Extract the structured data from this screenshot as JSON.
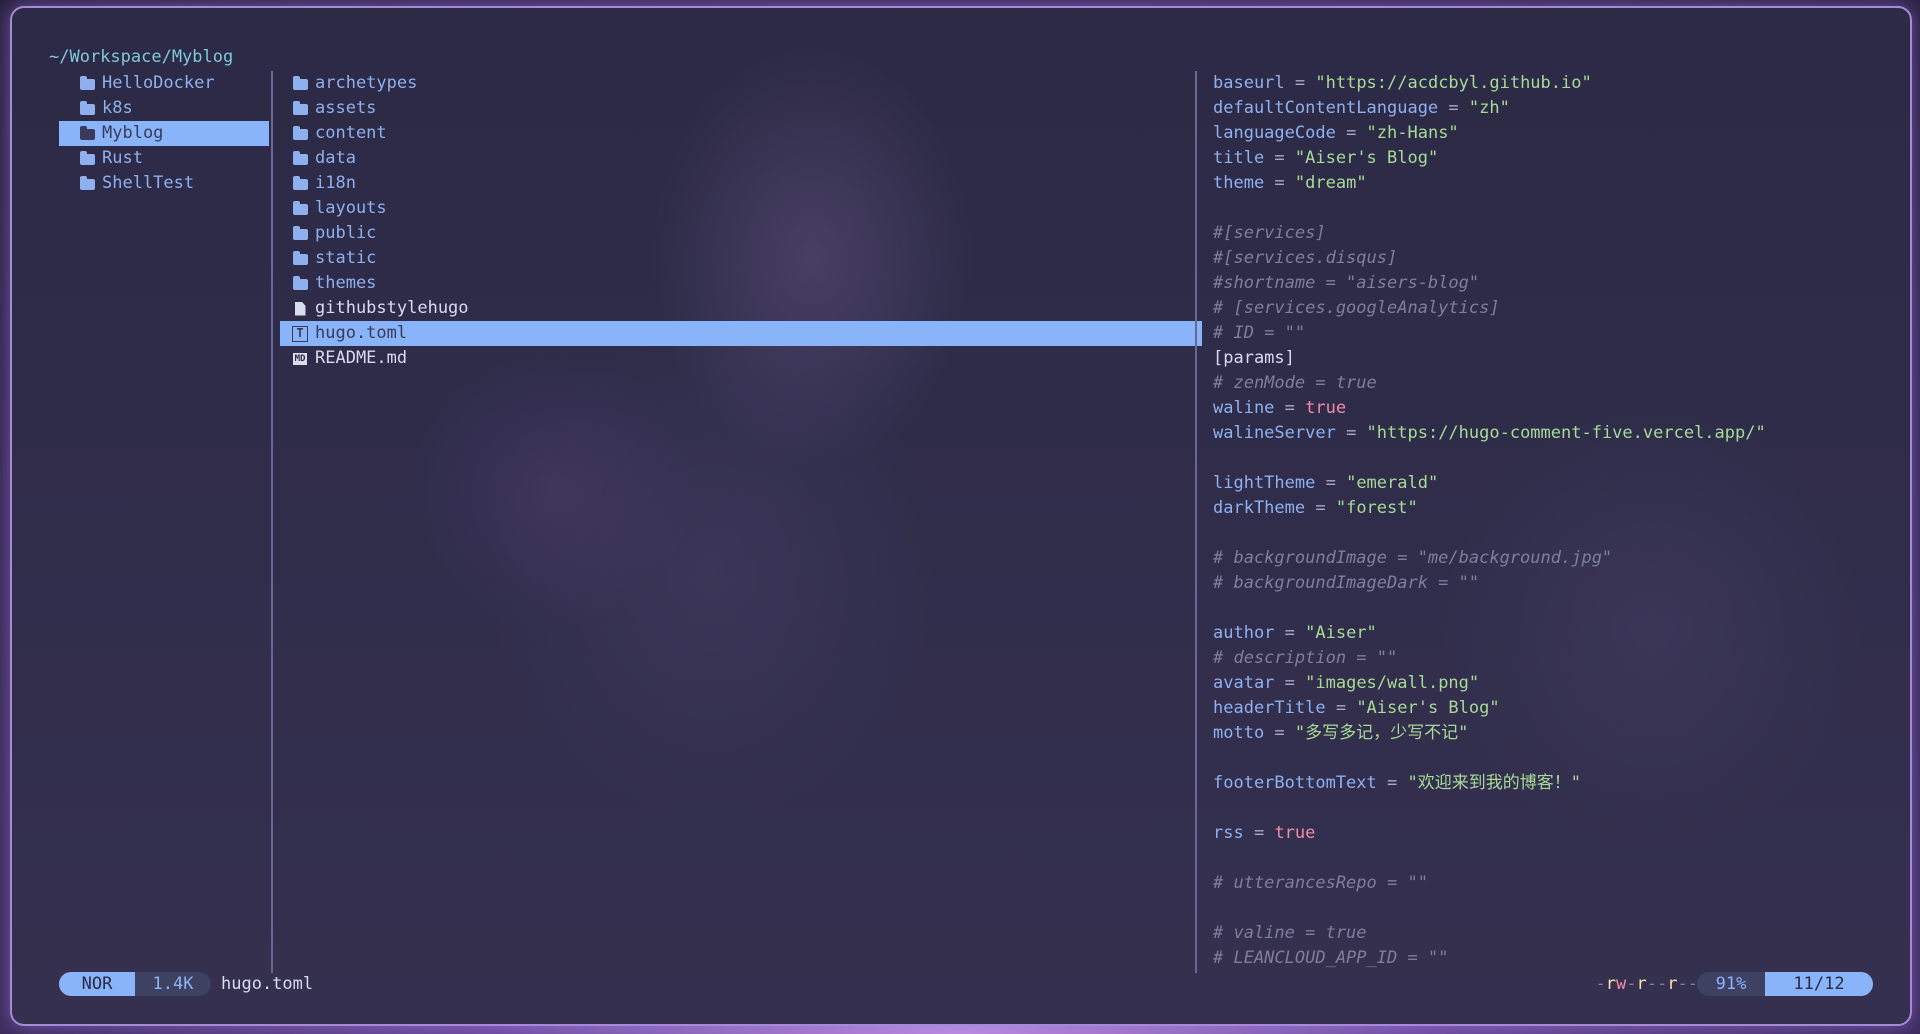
{
  "cwd": "~/Workspace/Myblog",
  "parent": [
    {
      "name": "HelloDocker",
      "selected": false
    },
    {
      "name": "k8s",
      "selected": false
    },
    {
      "name": "Myblog",
      "selected": true
    },
    {
      "name": "Rust",
      "selected": false
    },
    {
      "name": "ShellTest",
      "selected": false
    }
  ],
  "current": [
    {
      "name": "archetypes",
      "type": "dir"
    },
    {
      "name": "assets",
      "type": "dir"
    },
    {
      "name": "content",
      "type": "dir"
    },
    {
      "name": "data",
      "type": "dir"
    },
    {
      "name": "i18n",
      "type": "dir"
    },
    {
      "name": "layouts",
      "type": "dir"
    },
    {
      "name": "public",
      "type": "dir"
    },
    {
      "name": "static",
      "type": "dir"
    },
    {
      "name": "themes",
      "type": "dir"
    },
    {
      "name": "githubstylehugo",
      "type": "file"
    },
    {
      "name": "hugo.toml",
      "type": "toml",
      "selected": true
    },
    {
      "name": "README.md",
      "type": "md"
    }
  ],
  "preview": [
    [
      [
        "k",
        "baseurl"
      ],
      [
        "eq",
        " = "
      ],
      [
        "s",
        "\"https://acdcbyl.github.io\""
      ]
    ],
    [
      [
        "k",
        "defaultContentLanguage"
      ],
      [
        "eq",
        " = "
      ],
      [
        "s",
        "\"zh\""
      ]
    ],
    [
      [
        "k",
        "languageCode"
      ],
      [
        "eq",
        " = "
      ],
      [
        "s",
        "\"zh-Hans\""
      ]
    ],
    [
      [
        "k",
        "title"
      ],
      [
        "eq",
        " = "
      ],
      [
        "s",
        "\"Aiser's Blog\""
      ]
    ],
    [
      [
        "k",
        "theme"
      ],
      [
        "eq",
        " = "
      ],
      [
        "s",
        "\"dream\""
      ]
    ],
    [],
    [
      [
        "c",
        "#[services]"
      ]
    ],
    [
      [
        "c",
        "#[services.disqus]"
      ]
    ],
    [
      [
        "c",
        "#shortname = \"aisers-blog\""
      ]
    ],
    [
      [
        "c",
        "# [services.googleAnalytics]"
      ]
    ],
    [
      [
        "c",
        "# ID = \"\""
      ]
    ],
    [
      [
        "br",
        "[params]"
      ]
    ],
    [
      [
        "c",
        "# zenMode = true"
      ]
    ],
    [
      [
        "k",
        "waline"
      ],
      [
        "eq",
        " = "
      ],
      [
        "b",
        "true"
      ]
    ],
    [
      [
        "k",
        "walineServer"
      ],
      [
        "eq",
        " = "
      ],
      [
        "s",
        "\"https://hugo-comment-five.vercel.app/\""
      ]
    ],
    [],
    [
      [
        "k",
        "lightTheme"
      ],
      [
        "eq",
        " = "
      ],
      [
        "s",
        "\"emerald\""
      ]
    ],
    [
      [
        "k",
        "darkTheme"
      ],
      [
        "eq",
        " = "
      ],
      [
        "s",
        "\"forest\""
      ]
    ],
    [],
    [
      [
        "c",
        "# backgroundImage = \"me/background.jpg\""
      ]
    ],
    [
      [
        "c",
        "# backgroundImageDark = \"\""
      ]
    ],
    [],
    [
      [
        "k",
        "author"
      ],
      [
        "eq",
        " = "
      ],
      [
        "s",
        "\"Aiser\""
      ]
    ],
    [
      [
        "c",
        "# description = \"\""
      ]
    ],
    [
      [
        "k",
        "avatar"
      ],
      [
        "eq",
        " = "
      ],
      [
        "s",
        "\"images/wall.png\""
      ]
    ],
    [
      [
        "k",
        "headerTitle"
      ],
      [
        "eq",
        " = "
      ],
      [
        "s",
        "\"Aiser's Blog\""
      ]
    ],
    [
      [
        "k",
        "motto"
      ],
      [
        "eq",
        " = "
      ],
      [
        "s",
        "\"多写多记，少写不记\""
      ]
    ],
    [],
    [
      [
        "k",
        "footerBottomText"
      ],
      [
        "eq",
        " = "
      ],
      [
        "s",
        "\"欢迎来到我的博客！\""
      ]
    ],
    [],
    [
      [
        "k",
        "rss"
      ],
      [
        "eq",
        " = "
      ],
      [
        "b",
        "true"
      ]
    ],
    [],
    [
      [
        "c",
        "# utterancesRepo = \"\""
      ]
    ],
    [],
    [
      [
        "c",
        "# valine = true"
      ]
    ],
    [
      [
        "c",
        "# LEANCLOUD_APP_ID = \"\""
      ]
    ]
  ],
  "status": {
    "mode": "NOR",
    "size": "1.4K",
    "filename": "hugo.toml",
    "permissions": "-rw-r--r--",
    "percent": "91%",
    "position": "11/12"
  },
  "colors": {
    "accent": "#89b4fa",
    "string": "#a6da95",
    "bool": "#f38ba8",
    "comment": "#7d7f9c"
  }
}
